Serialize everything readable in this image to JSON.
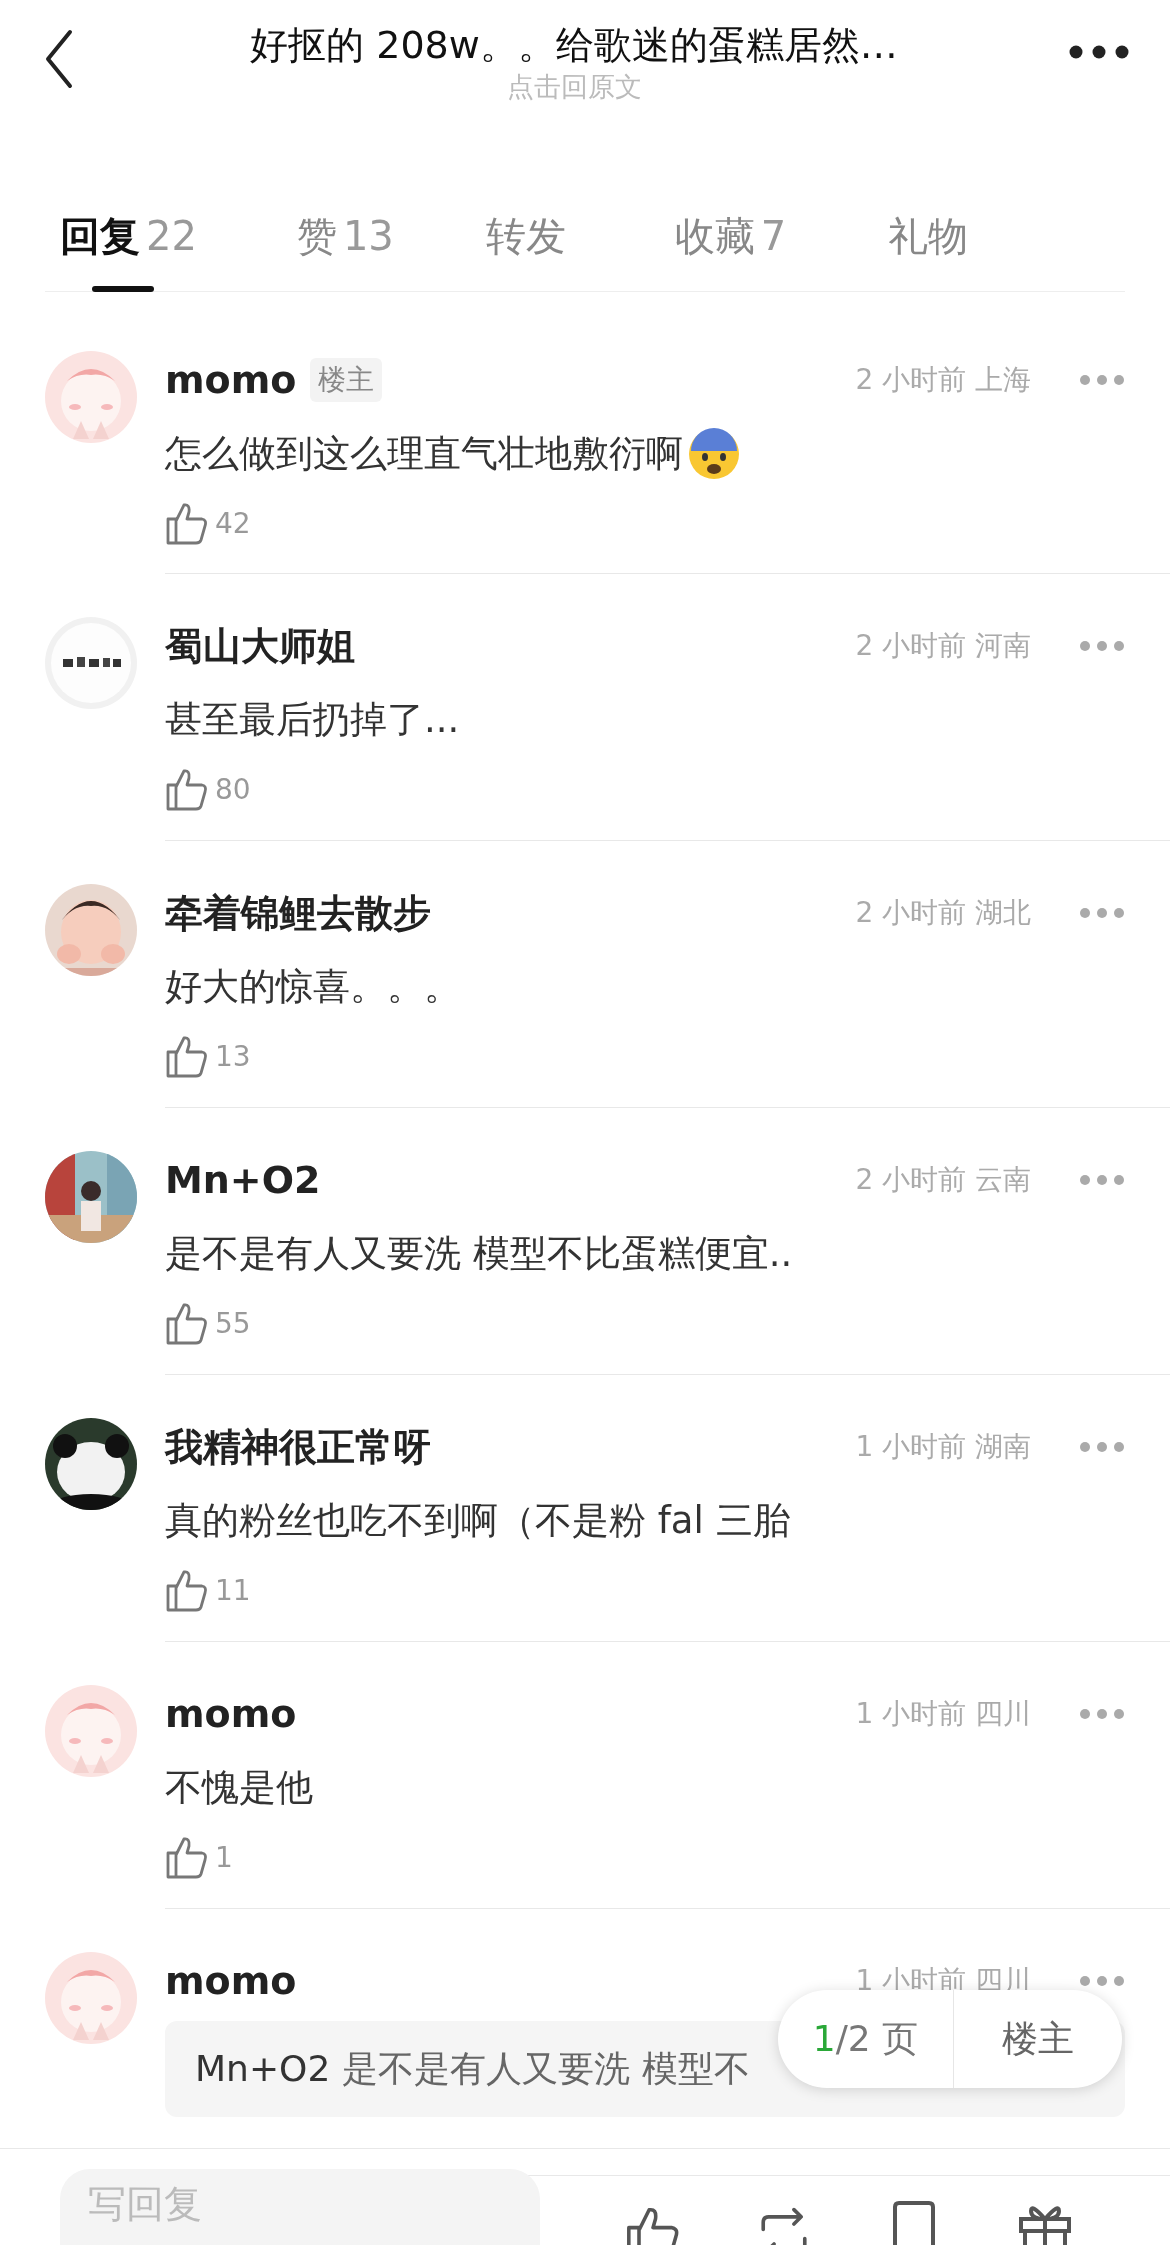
{
  "header": {
    "title": "好抠的 208w。。给歌迷的蛋糕居然…",
    "subtitle": "点击回原文"
  },
  "tabs": [
    {
      "label": "回复",
      "count": "22",
      "selected": true
    },
    {
      "label": "赞",
      "count": "13",
      "selected": false
    },
    {
      "label": "转发",
      "selected": false
    },
    {
      "label": "收藏",
      "count": "7",
      "selected": false
    },
    {
      "label": "礼物",
      "selected": false
    }
  ],
  "comments": [
    {
      "author": "momo",
      "badge": "楼主",
      "time": "2 小时前 上海",
      "text": "怎么做到这么理直气壮地敷衍啊",
      "kind": "text_emoji",
      "likes": "42"
    },
    {
      "author": "蜀山大师姐",
      "time": "2 小时前 河南",
      "text": "甚至最后扔掉了...",
      "kind": "text",
      "likes": "80"
    },
    {
      "author": "牵着锦鲤去散步",
      "time": "2 小时前 湖北",
      "text": "好大的惊喜。。。",
      "kind": "text",
      "likes": "13"
    },
    {
      "author": "Mn+O2",
      "time": "2 小时前 云南",
      "text": "是不是有人又要洗 模型不比蛋糕便宜..",
      "kind": "text",
      "likes": "55"
    },
    {
      "author": "我精神很正常呀",
      "time": "1 小时前 湖南",
      "text": "真的粉丝也吃不到啊（不是粉 fal 三胎",
      "kind": "text",
      "likes": "11"
    },
    {
      "author": "momo",
      "time": "1 小时前 四川",
      "text": "不愧是他",
      "kind": "text",
      "likes": "1"
    },
    {
      "author": "momo",
      "time": "1 小时前 四川",
      "quote_author": "Mn+O2",
      "quote_text": "是不是有人又要洗 模型不",
      "kind": "quote"
    }
  ],
  "pager": {
    "current": "1",
    "rest": "/2 页",
    "button": "楼主"
  },
  "reply_bar": {
    "placeholder": "写回复"
  }
}
